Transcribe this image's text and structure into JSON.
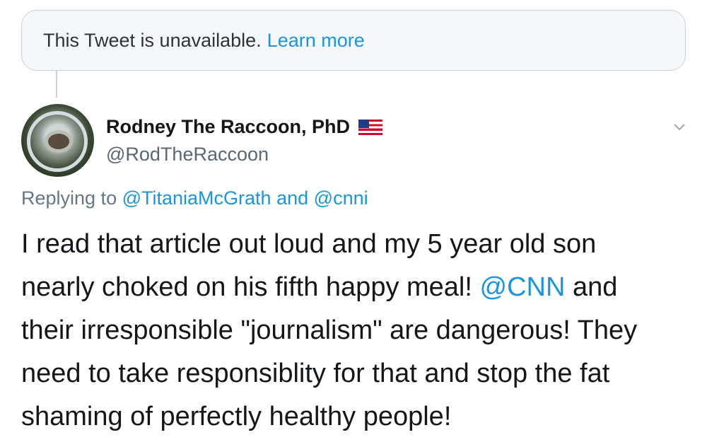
{
  "unavailable_notice": {
    "text": "This Tweet is unavailable.",
    "link": "Learn more"
  },
  "author": {
    "name": "Rodney The Raccoon, PhD",
    "handle": "@RodTheRaccoon"
  },
  "reply": {
    "prefix": "Replying to",
    "mention1": "@TitaniaMcGrath",
    "conjunction": "and",
    "mention2": "@cnni"
  },
  "tweet": {
    "line1": "I read that article out loud and my 5 year old son",
    "line2_before": "nearly choked on his fifth happy meal! ",
    "line2_mention": "@CNN",
    "line2_after": " and",
    "line3": "their irresponsible \"journalism\" are dangerous! They",
    "line4": "need to take responsiblity for that and stop the fat",
    "line5": "shaming of perfectly healthy people!"
  },
  "colors": {
    "link_blue": "#1b95e0",
    "secondary_text": "#657786",
    "primary_text": "#14171a"
  },
  "icons": {
    "flag": "us-flag-icon",
    "menu": "chevron-down-icon"
  }
}
